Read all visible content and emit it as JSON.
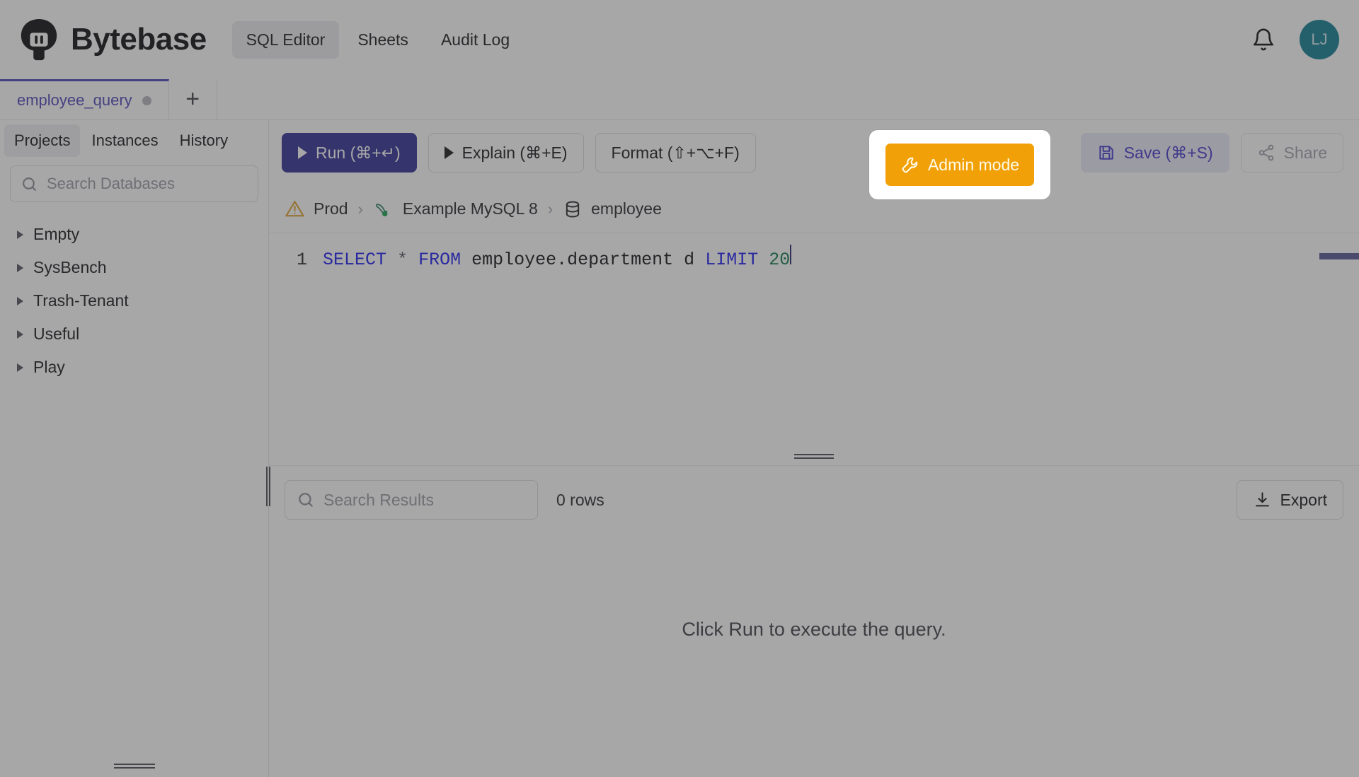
{
  "brand": {
    "name": "Bytebase",
    "logo_icon": "bytebase-logo-icon"
  },
  "topnav": {
    "items": [
      {
        "label": "SQL Editor",
        "active": true
      },
      {
        "label": "Sheets",
        "active": false
      },
      {
        "label": "Audit Log",
        "active": false
      }
    ],
    "bell_icon": "bell-icon",
    "avatar_initials": "LJ",
    "avatar_color": "#117f91"
  },
  "tabstrip": {
    "tabs": [
      {
        "label": "employee_query",
        "dirty": true
      }
    ],
    "add_label": "+",
    "active_color": "#4f46b8"
  },
  "sidebar": {
    "tabs": [
      {
        "label": "Projects",
        "active": true
      },
      {
        "label": "Instances",
        "active": false
      },
      {
        "label": "History",
        "active": false
      }
    ],
    "search": {
      "placeholder": "Search Databases",
      "value": "",
      "icon": "search-icon"
    },
    "tree": [
      {
        "label": "Empty"
      },
      {
        "label": "SysBench"
      },
      {
        "label": "Trash-Tenant"
      },
      {
        "label": "Useful"
      },
      {
        "label": "Play"
      }
    ]
  },
  "toolbar": {
    "run_label": "Run (⌘+↵)",
    "explain_label": "Explain (⌘+E)",
    "format_label": "Format (⇧+⌥+F)",
    "admin_label": "Admin mode",
    "admin_icon": "wrench-icon",
    "admin_color": "#f2a007",
    "save_label": "Save (⌘+S)",
    "save_icon": "floppy-disk-icon",
    "save_color": "#4338ca",
    "share_label": "Share",
    "share_icon": "share-icon",
    "primary_color": "#312e94"
  },
  "breadcrumb": {
    "environment": "Prod",
    "environment_icon": "warning-triangle-icon",
    "instance": "Example MySQL 8",
    "instance_icon": "mysql-dolphin-icon",
    "database": "employee",
    "database_icon": "database-icon",
    "separator": "›"
  },
  "editor": {
    "line_number": "1",
    "tokens": [
      {
        "t": "SELECT",
        "c": "kw"
      },
      {
        "t": " ",
        "c": "sp"
      },
      {
        "t": "*",
        "c": "op"
      },
      {
        "t": " ",
        "c": "sp"
      },
      {
        "t": "FROM",
        "c": "kw"
      },
      {
        "t": " ",
        "c": "sp"
      },
      {
        "t": "employee.department",
        "c": "id"
      },
      {
        "t": " ",
        "c": "sp"
      },
      {
        "t": "d",
        "c": "id"
      },
      {
        "t": " ",
        "c": "sp"
      },
      {
        "t": "LIMIT",
        "c": "kw"
      },
      {
        "t": " ",
        "c": "sp"
      },
      {
        "t": "20",
        "c": "num"
      }
    ],
    "full_text": "SELECT * FROM employee.department d LIMIT 20"
  },
  "results": {
    "search": {
      "placeholder": "Search Results",
      "value": "",
      "icon": "search-icon"
    },
    "rows_label": "0 rows",
    "export_label": "Export",
    "export_icon": "download-icon",
    "empty_message": "Click Run to execute the query."
  }
}
